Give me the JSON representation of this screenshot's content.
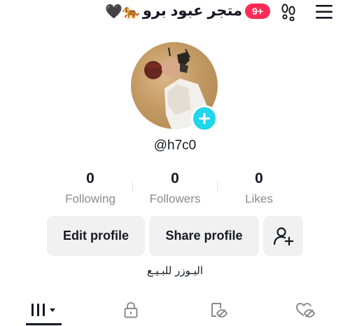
{
  "header": {
    "title": "متجر عبود برو",
    "title_emoji_left": "🖤",
    "title_emoji_right": "🐅",
    "notification_badge": "9+",
    "icons": [
      "footprints-icon",
      "hamburger-menu-icon"
    ]
  },
  "profile": {
    "username": "@h7c0",
    "avatar_add_icon": "plus-icon",
    "accent_color": "#20d5ec",
    "badge_color": "#fe2c55"
  },
  "stats": [
    {
      "value": "0",
      "label": "Following"
    },
    {
      "value": "0",
      "label": "Followers"
    },
    {
      "value": "0",
      "label": "Likes"
    }
  ],
  "actions": {
    "edit_profile": "Edit profile",
    "share_profile": "Share profile",
    "add_friend_icon": "add-user-icon"
  },
  "bio": "اليـوزر للبـيـع",
  "tabs": [
    {
      "name": "videos",
      "icon": "grid-bars-icon",
      "active": true
    },
    {
      "name": "private",
      "icon": "lock-icon",
      "active": false
    },
    {
      "name": "reposts",
      "icon": "repost-eye-off-icon",
      "active": false
    },
    {
      "name": "liked",
      "icon": "heart-eye-off-icon",
      "active": false
    }
  ]
}
